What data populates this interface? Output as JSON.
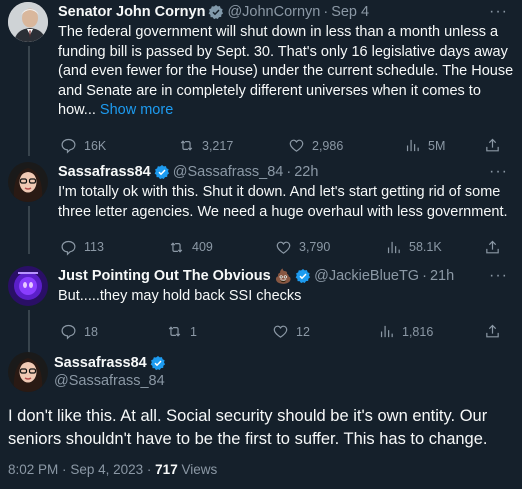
{
  "tweets": [
    {
      "name": "Senator John Cornyn",
      "handle": "@JohnCornyn",
      "time": "Sep 4",
      "text": "The federal government will shut down in less than a month unless a funding bill is passed by Sept. 30. That's only 16 legislative days away (and even fewer for the House) under the current schedule. The House and Senate are in completely different universes when it comes to how...",
      "show_more": "Show more",
      "replies": "16K",
      "retweets": "3,217",
      "likes": "2,986",
      "views": "5M"
    },
    {
      "name": "Sassafrass84",
      "handle": "@Sassafrass_84",
      "time": "22h",
      "text": "I'm totally ok with this. Shut it down. And let's start getting rid of some three letter agencies. We need a huge overhaul with less government.",
      "replies": "113",
      "retweets": "409",
      "likes": "3,790",
      "views": "58.1K"
    },
    {
      "name": "Just Pointing Out The Obvious",
      "name_emoji": "💩",
      "handle": "@JackieBlueTG",
      "time": "21h",
      "text": "But.....they may hold back SSI checks",
      "replies": "18",
      "retweets": "1",
      "likes": "12",
      "views": "1,816"
    }
  ],
  "main_tweet": {
    "name": "Sassafrass84",
    "handle": "@Sassafrass_84",
    "text": "I don't like this. At all. Social security should be it's own entity. Our seniors shouldn't have to be the first to suffer. This has to change.",
    "time": "8:02 PM",
    "date": "Sep 4, 2023",
    "views_count": "717",
    "views_label": "Views"
  },
  "separator": "·",
  "more_glyph": "···",
  "colors": {
    "background": "#15202b",
    "text": "#f7f9f9",
    "muted": "#8b98a5",
    "link": "#1d9bf0",
    "verified": "#1d9bf0",
    "thread_line": "#38444d"
  }
}
